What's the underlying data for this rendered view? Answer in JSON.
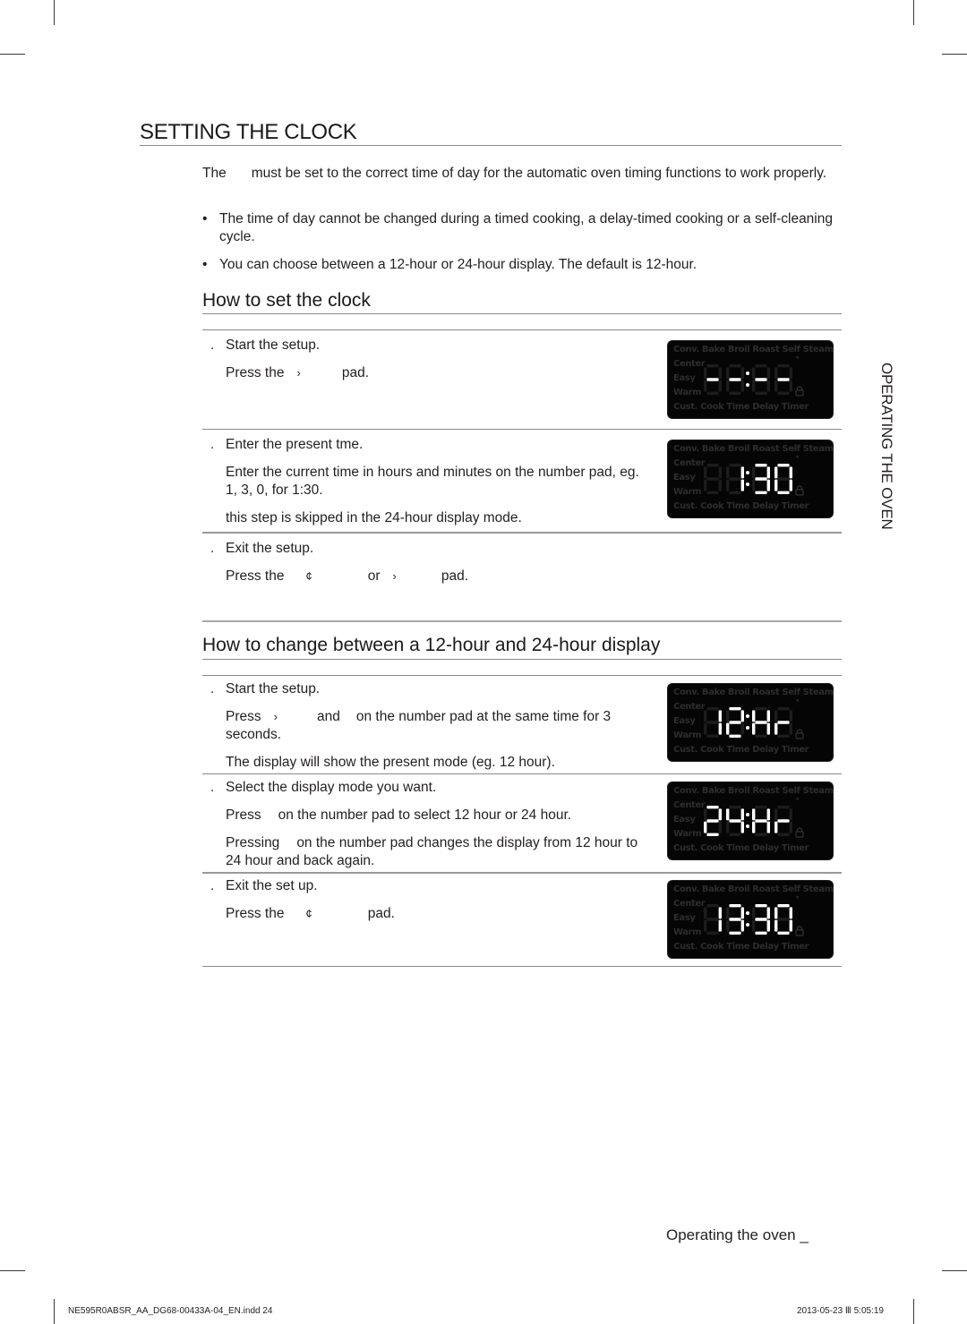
{
  "page": {
    "title": "SETTING THE CLOCK",
    "intro": {
      "before_gap": "The",
      "after_gap": "must be set to the correct time of day for the automatic oven timing functions to work properly."
    },
    "bullets": [
      "The time of day cannot be changed during a timed cooking, a delay-timed cooking or a self-cleaning cycle.",
      "You can choose between a 12-hour or 24-hour display. The default is 12-hour."
    ],
    "bullet_symbol": "•",
    "side_tab": "OPERATING THE OVEN",
    "footer_label": "Operating the oven _",
    "slug_left": "NE595R0ABSR_AA_DG68-00433A-04_EN.indd   24",
    "slug_right": "2013-05-23   Ⅲ 5:05:19"
  },
  "section_set_clock": {
    "heading": "How to set the clock",
    "steps": [
      {
        "num": ".",
        "title": "Start the setup.",
        "lines": [
          {
            "parts": [
              "Press the",
              "›",
              "pad."
            ]
          }
        ],
        "display": "--:--"
      },
      {
        "num": ".",
        "title": "Enter the present tme.",
        "lines": [
          {
            "text": "Enter the current time in hours and minutes on the number pad, eg. 1, 3, 0, for 1:30."
          },
          {
            "text": "this step is skipped in the 24-hour display mode."
          }
        ],
        "display": "1:30"
      },
      {
        "num": ".",
        "title": "Exit the setup.",
        "lines": [
          {
            "parts": [
              "Press the",
              "¢",
              "or",
              "›",
              "pad."
            ]
          }
        ]
      }
    ]
  },
  "section_change_mode": {
    "heading": "How to change between a 12-hour and 24-hour display",
    "steps": [
      {
        "num": ".",
        "title": "Start the setup.",
        "lines": [
          {
            "parts": [
              "Press",
              "›",
              "and",
              "on the number pad at the same time for 3 seconds."
            ]
          },
          {
            "text": "The display will show the present mode (eg. 12 hour)."
          }
        ],
        "display": "12Hr"
      },
      {
        "num": ".",
        "title": "Select the display mode you want.",
        "lines": [
          {
            "parts": [
              "Press",
              "on the number pad to select 12 hour or 24 hour."
            ]
          },
          {
            "parts": [
              "Pressing",
              "on the number pad changes the display from 12 hour to 24 hour and back again."
            ]
          }
        ],
        "display": "24Hr"
      },
      {
        "num": ".",
        "title": "Exit the set up.",
        "lines": [
          {
            "parts": [
              "Press the",
              "¢",
              "pad."
            ]
          }
        ],
        "display": "13:30"
      }
    ]
  },
  "lcd_labels": {
    "top": [
      "Conv.",
      "Bake",
      "Broil",
      "Roast",
      "Self",
      "Steam"
    ],
    "side": [
      "Center",
      "Easy",
      "Warm"
    ],
    "bottom": [
      "Cust.",
      "Cook",
      "Time",
      "Delay",
      "Timer"
    ],
    "degree": "°"
  }
}
